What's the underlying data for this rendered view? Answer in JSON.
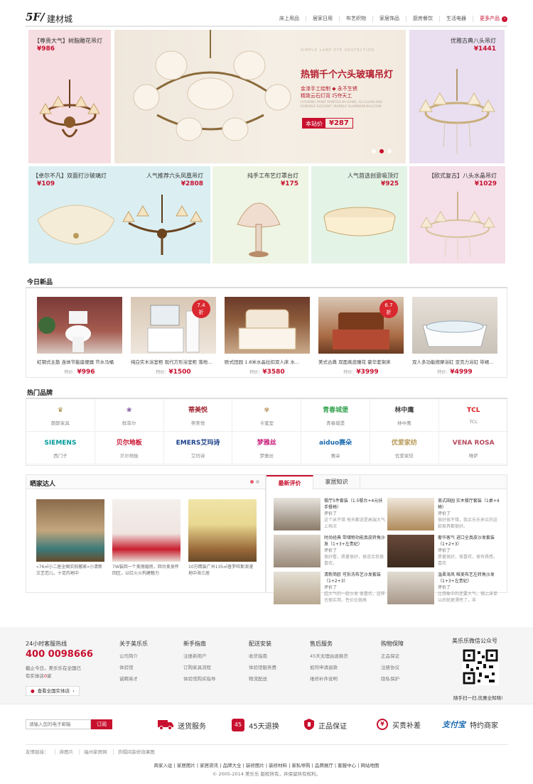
{
  "floor": {
    "number": "5F/",
    "name": "建材城",
    "nav": [
      "床上用品",
      "居家日用",
      "布艺织物",
      "家居饰品",
      "厨房餐饮",
      "生活电器"
    ],
    "more": "更多产品",
    "more_icon": "arrow-right-icon"
  },
  "top_tiles": [
    {
      "title": "【尊贵大气】树脂雕花吊灯",
      "price": "¥986"
    },
    {
      "title": "优雅古典八头吊灯",
      "price": "¥1441"
    }
  ],
  "banner": {
    "sub": "SIMPLE LAMP EYE PROTECTION",
    "title": "热销千个六头玻璃吊灯",
    "line1": "金漆手工绘制 ◆ 永不生锈",
    "line2": "精致云石灯背  巧夺天工",
    "eng": "HYGIENIC PAINT PAINTED BY HAND, AS CLEAN AND DURABLE ELEGANT, MARBLE ALUMINUM BALLOON",
    "price_label": "本站价",
    "price": "¥287",
    "dots": 3,
    "active_dot": 1
  },
  "small_tiles": [
    {
      "title": "【卓尔不凡】双面打沙玻璃灯",
      "price": "¥109",
      "bg": "#dbeff2"
    },
    {
      "title": "人气推荐六头凤凰吊灯",
      "price": "¥2808",
      "bg": "#dbeff2"
    },
    {
      "title": "纯手工布艺灯罩台灯",
      "price": "¥175",
      "bg": "#eef5e4"
    },
    {
      "title": "人气首选创意吸顶灯",
      "price": "¥925",
      "bg": "#e3f3e6"
    },
    {
      "title": "【欧式复古】八头水晶吊灯",
      "price": "¥1029",
      "bg": "#f5dfe8"
    }
  ],
  "new_section": {
    "title": "今日新品",
    "items": [
      {
        "name": "虹钢式主筋 连体节能座便器 节水马桶",
        "price_label": "特价：",
        "price": "¥996",
        "discount": ""
      },
      {
        "name": "纯白实木浴室柜 现代方形浴室柜 落地...",
        "price_label": "特价：",
        "price": "¥1500",
        "discount": "7.4折"
      },
      {
        "name": "欧式田园 1.8米水晶拉扣双人床 水...",
        "price_label": "特价：",
        "price": "¥3580",
        "discount": ""
      },
      {
        "name": "美式古典 双面真皮雕花 豪华套架床",
        "price_label": "特价：",
        "price": "¥3999",
        "discount": "6.7折"
      },
      {
        "name": "双人多功能按摩浴缸 亚克力浴缸 带裙...",
        "price_label": "特价：",
        "price": "¥4999",
        "discount": ""
      }
    ]
  },
  "brand_section": {
    "title": "热门品牌",
    "brands": [
      {
        "logo": "♛",
        "name": "朗斯家具",
        "color": "#a0843e"
      },
      {
        "logo": "❀",
        "name": "鲜菲尔",
        "color": "#7a4a9a"
      },
      {
        "logo": "蒂美悦",
        "name": "蒂美悦",
        "color": "#a0222e"
      },
      {
        "logo": "✾",
        "name": "卡蜜室",
        "color": "#b8925a"
      },
      {
        "logo": "青春城堡",
        "name": "青春城堡",
        "color": "#3aa655"
      },
      {
        "logo": "林中鹰",
        "name": "林中鹰",
        "color": "#444"
      },
      {
        "logo": "TCL",
        "name": "TCL",
        "color": "#d71920"
      },
      {
        "logo": "SIEMENS",
        "name": "西门子",
        "color": "#009999"
      },
      {
        "logo": "贝尔地板",
        "name": "贝尔地板",
        "color": "#c8102e"
      },
      {
        "logo": "EMERS艾玛诗",
        "name": "艾玛诗",
        "color": "#1a3f8a"
      },
      {
        "logo": "梦雅丝",
        "name": "梦雅丝",
        "color": "#c81e7a"
      },
      {
        "logo": "aiduo赛朵",
        "name": "赛朵",
        "color": "#1a6ab0"
      },
      {
        "logo": "优爱家纺",
        "name": "优爱家纺",
        "color": "#b89a5a"
      },
      {
        "logo": "VENA ROSA",
        "name": "唯萨",
        "color": "#b5485e"
      }
    ]
  },
  "showcase": {
    "title": "晒家达人",
    "items": [
      {
        "caption": "«76㎡小二居全图实拍搬家»小清新文艺范儿，十足的地中"
      },
      {
        "caption": "7W装回一个美丽婚房，回台美身怀回区，以红火火构建魅力"
      },
      {
        "caption": "10万精装广州135㎡普罗旺斯浪漫地中海三居"
      }
    ]
  },
  "reviews": {
    "tabs": [
      "最新评价",
      "家居知识"
    ],
    "items": [
      {
        "title": "餐厅5件套装（1.5餐台+4元扶手餐椅）",
        "label": "评价了",
        "comment": "这个床不错 每天都说是高端大气上档次"
      },
      {
        "title": "美式田园 实木餐厅套装（1桌+4椅）",
        "label": "评价了",
        "comment": "很好很不错，我买乐乐来买的这款家具都很好。"
      },
      {
        "title": "时尚经典 带储物功能真皮转角沙发（1+3+左贵妃）",
        "label": "评价了",
        "comment": "很好看，质量很好，很适合我很喜欢。"
      },
      {
        "title": "奢华客气 进口全真皮沙发套装（1+2+3）",
        "label": "评价了",
        "comment": "质量很好，很喜欢，很有质感，喜欢"
      },
      {
        "title": "清新简欧 可拆洗布艺沙发套装（1+2+3）",
        "label": "评价了",
        "comment": "超大气的一款沙发 很喜欢，这样也很实用，性价比很高"
      },
      {
        "title": "温柔海风 唯美布艺左转角沙发（1+3+左贵妃）",
        "label": "评价了",
        "comment": "比想象中的还要大气，铺上床单以后就更漂亮了，非"
      }
    ]
  },
  "footer": {
    "hotline_label": "24小时客服热线",
    "hotline": "400 0098666",
    "hotline_note1": "截止今日，美乐乐在全国已",
    "hotline_note2": "有实体店",
    "hotline_note3": "家",
    "store_link": "查看全国实体店",
    "columns": [
      {
        "title": "关于美乐乐",
        "links": [
          "公司简介",
          "体验馆",
          "诚聘英才"
        ]
      },
      {
        "title": "新手指南",
        "links": [
          "注册新用户",
          "订购家具流程",
          "体验馆购买指导"
        ]
      },
      {
        "title": "配送安装",
        "links": [
          "收货指南",
          "体验馆服务费",
          "物流配送"
        ]
      },
      {
        "title": "售后服务",
        "links": [
          "45天无理由退换货",
          "如何申请退款",
          "维修补件说明"
        ]
      },
      {
        "title": "购物保障",
        "links": [
          "正品保证",
          "注册协议",
          "隐私保护"
        ]
      }
    ],
    "wechat_title": "美乐乐微信公众号",
    "wechat_note": "随手扫一扫,优惠全知晓!"
  },
  "service_bar": {
    "email_placeholder": "请输入您的电子邮箱",
    "subscribe": "订阅",
    "items": [
      {
        "icon": "truck-icon",
        "label": "送货服务"
      },
      {
        "icon": "45-days-icon",
        "label": "45天退换"
      },
      {
        "icon": "shield-icon",
        "label": "正品保证"
      },
      {
        "icon": "yen-icon",
        "label": "买贵补差"
      },
      {
        "icon": "alipay-icon",
        "label": "特约商家",
        "brand": "支付宝"
      }
    ]
  },
  "friend_links": {
    "label": "友情链接：",
    "links": [
      "床图片",
      "福州家居网",
      "衣帽间装修效果图"
    ]
  },
  "bottom_links": [
    "商家入驻",
    "家居图片",
    "家居资讯",
    "品牌大全",
    "装修图片",
    "装修材料",
    "家私导购",
    "品牌展厅",
    "客服中心",
    "网站地图"
  ],
  "copyright": "© 2005-2014 美乐乐 版权所有，并保留所有权利。",
  "colors": {
    "accent": "#c8102e",
    "border": "#e5e5e5",
    "footer_bg": "#f5f5f5"
  }
}
